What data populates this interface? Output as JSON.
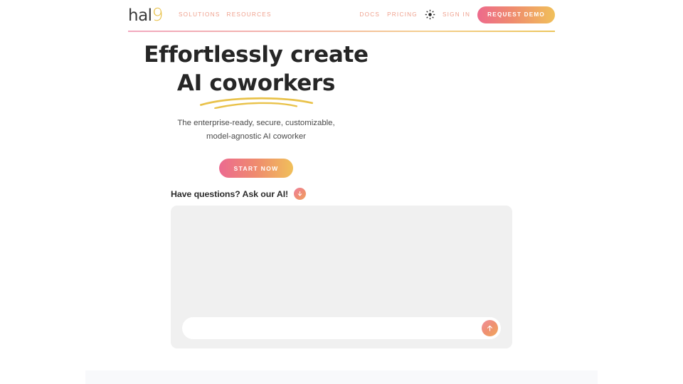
{
  "header": {
    "logo": {
      "primary": "hal",
      "accent": "9"
    },
    "nav_left": [
      {
        "label": "SOLUTIONS",
        "name": "nav-solutions"
      },
      {
        "label": "RESOURCES",
        "name": "nav-resources"
      }
    ],
    "nav_right": [
      {
        "label": "DOCS",
        "name": "nav-docs"
      },
      {
        "label": "PRICING",
        "name": "nav-pricing"
      },
      {
        "label": "SIGN IN",
        "name": "nav-sign-in"
      }
    ],
    "theme_toggle_icon": "sun-icon",
    "demo_button": "REQUEST DEMO",
    "accent_gradient_start": "#ed6a8c",
    "accent_gradient_end": "#f0c05a",
    "nav_link_color": "#efa08d"
  },
  "hero": {
    "title_line1": "Effortlessly create",
    "title_line2": "AI coworkers",
    "underline_color": "#e9c24a",
    "subtitle": "The enterprise-ready, secure, customizable, model-agnostic AI coworker",
    "cta_label": "START NOW"
  },
  "ask": {
    "text": "Have questions? Ask our AI!",
    "badge_icon": "arrow-down-icon"
  },
  "chat": {
    "input_value": "",
    "input_placeholder": "",
    "send_icon": "arrow-up-icon",
    "panel_background": "#f0f0f0"
  },
  "bottom_band": {
    "background": "#f8f9fb"
  }
}
